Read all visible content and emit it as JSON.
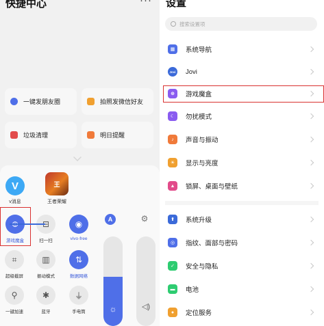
{
  "left": {
    "title": "快捷中心",
    "more": "···",
    "cards": [
      {
        "label": "一键发朋友圈",
        "color": "#4f6fe8"
      },
      {
        "label": "拍照发微信好友",
        "color": "#f0a030"
      },
      {
        "label": "垃圾清理",
        "color": "#e24b4b"
      },
      {
        "label": "明日提醒",
        "color": "#f07a3a"
      }
    ],
    "apps": [
      {
        "label": "v消息",
        "glyph": "V"
      },
      {
        "label": "王者荣耀",
        "glyph": "王"
      }
    ],
    "tiles": {
      "game": {
        "label": "游戏魔盒",
        "glyph": "⊕"
      },
      "scan": {
        "label": "扫一扫",
        "glyph": "⊟"
      },
      "vivo": {
        "label": "vivo·free",
        "glyph": "◉"
      },
      "shot": {
        "label": "超级截屏",
        "glyph": "⌗"
      },
      "vib": {
        "label": "振动模式",
        "glyph": "▥"
      },
      "data": {
        "label": "数据网络",
        "glyph": "⇅"
      },
      "boost": {
        "label": "一键加速",
        "glyph": "⚲"
      },
      "bt": {
        "label": "蓝牙",
        "glyph": "✱"
      },
      "torch": {
        "label": "手电筒",
        "glyph": "⏚"
      }
    },
    "auto_brightness": "A",
    "brightness_level": 0.55
  },
  "right": {
    "title": "设置",
    "search_placeholder": "搜索设置项",
    "groups": [
      [
        {
          "label": "系统导航",
          "icon": "nav-icon",
          "color": "#4f6fe8",
          "glyph": "▦"
        },
        {
          "label": "Jovi",
          "icon": "jovi-icon",
          "color": "#3b6ad9",
          "glyph": "Jovi"
        },
        {
          "label": "游戏魔盒",
          "icon": "game-box-icon",
          "color": "#8a5cf0",
          "glyph": "⊕"
        },
        {
          "label": "勿扰模式",
          "icon": "moon-icon",
          "color": "#8a5cf0",
          "glyph": "☾"
        },
        {
          "label": "声音与振动",
          "icon": "sound-icon",
          "color": "#f07a3a",
          "glyph": "♪"
        },
        {
          "label": "显示与亮度",
          "icon": "brightness-icon",
          "color": "#f0a030",
          "glyph": "☀"
        },
        {
          "label": "锁屏、桌面与壁纸",
          "icon": "wallpaper-icon",
          "color": "#e24b8a",
          "glyph": "▲"
        }
      ],
      [
        {
          "label": "系统升级",
          "icon": "upgrade-icon",
          "color": "#3b6ad9",
          "glyph": "⬆"
        },
        {
          "label": "指纹、面部与密码",
          "icon": "fingerprint-icon",
          "color": "#4f6fe8",
          "glyph": "◎"
        },
        {
          "label": "安全与隐私",
          "icon": "shield-icon",
          "color": "#2ecc71",
          "glyph": "✓"
        },
        {
          "label": "电池",
          "icon": "battery-icon",
          "color": "#2ecc71",
          "glyph": "▬"
        },
        {
          "label": "定位服务",
          "icon": "location-icon",
          "color": "#f0a030",
          "glyph": "●"
        }
      ]
    ]
  },
  "highlight_color": "#d9302f"
}
